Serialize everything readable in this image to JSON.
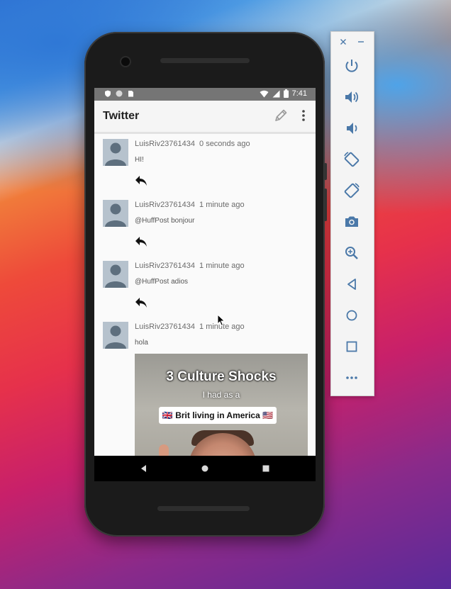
{
  "status_bar": {
    "time": "7:41"
  },
  "app": {
    "title": "Twitter"
  },
  "tweets": [
    {
      "user": "LuisRiv23761434",
      "time": "0 seconds ago",
      "text": "HI!"
    },
    {
      "user": "LuisRiv23761434",
      "time": "1 minute ago",
      "text": "@HuffPost bonjour"
    },
    {
      "user": "LuisRiv23761434",
      "time": "1 minute ago",
      "text": "@HuffPost adios"
    },
    {
      "user": "LuisRiv23761434",
      "time": "1 minute ago",
      "text": "hola"
    }
  ],
  "media": {
    "headline": "3 Culture Shocks",
    "subline": "I had as a",
    "chip": "🇬🇧 Brit living in America 🇺🇸"
  },
  "colors": {
    "status_bar": "#757575",
    "app_bar": "#f5f5f5",
    "screen_bg": "#fafafa",
    "avatar": "#b6c2cd",
    "toolbar_icon": "#4a78a8"
  },
  "icons": {
    "appbar": [
      "edit-icon",
      "more-vert-icon"
    ],
    "toolbar": [
      "close-icon",
      "minimize-icon",
      "power-icon",
      "volume-up-icon",
      "volume-down-icon",
      "rotate-left-icon",
      "rotate-right-icon",
      "camera-icon",
      "zoom-icon",
      "back-icon",
      "home-icon",
      "overview-icon",
      "more-horiz-icon"
    ]
  }
}
